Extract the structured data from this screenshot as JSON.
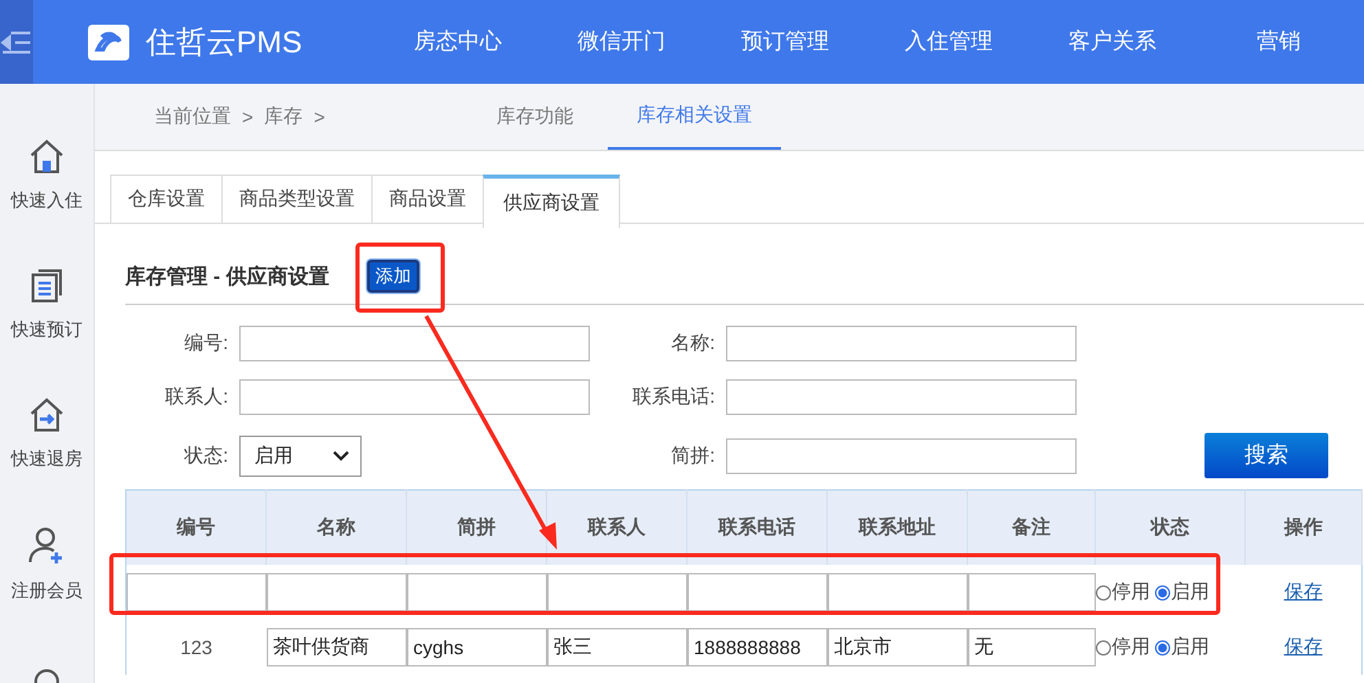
{
  "app": {
    "name": "住哲云PMS"
  },
  "top_nav": [
    {
      "label": "房态中心"
    },
    {
      "label": "微信开门"
    },
    {
      "label": "预订管理"
    },
    {
      "label": "入住管理"
    },
    {
      "label": "客户关系"
    },
    {
      "label": "营销"
    }
  ],
  "sidebar": [
    {
      "kind": "checkin",
      "label": "快速入住"
    },
    {
      "kind": "booking",
      "label": "快速预订"
    },
    {
      "kind": "checkout",
      "label": "快速退房"
    },
    {
      "kind": "member",
      "label": "注册会员"
    },
    {
      "kind": "search"
    }
  ],
  "breadcrumb": [
    "当前位置",
    ">",
    "库存",
    ">"
  ],
  "sub_tabs": [
    {
      "label": "库存功能",
      "selected": false
    },
    {
      "label": "库存相关设置",
      "selected": true
    }
  ],
  "tabs": [
    {
      "label": "仓库设置",
      "selected": false
    },
    {
      "label": "商品类型设置",
      "selected": false
    },
    {
      "label": "商品设置",
      "selected": false
    },
    {
      "label": "供应商设置",
      "selected": true
    }
  ],
  "section": {
    "title": "库存管理 - 供应商设置",
    "add_button": "添加"
  },
  "filters": [
    {
      "label": "编号:",
      "kind": "input"
    },
    {
      "label": "名称:",
      "kind": "input"
    },
    {
      "label": "联系人:",
      "kind": "input"
    },
    {
      "label": "联系电话:",
      "kind": "input"
    },
    {
      "label": "状态:",
      "kind": "select",
      "value": "启用"
    },
    {
      "label": "简拼:",
      "kind": "input"
    }
  ],
  "search_button": "搜索",
  "table": {
    "columns": [
      "编号",
      "名称",
      "简拼",
      "联系人",
      "联系电话",
      "联系地址",
      "备注",
      "状态",
      "操作"
    ],
    "rows": [
      {
        "cells": [
          {
            "kind": "input"
          },
          {
            "kind": "input"
          },
          {
            "kind": "input"
          },
          {
            "kind": "input"
          },
          {
            "kind": "input"
          },
          {
            "kind": "input"
          },
          {
            "kind": "input"
          }
        ],
        "status": [
          {
            "label": "停用",
            "selected": false
          },
          {
            "label": "启用",
            "selected": true
          }
        ],
        "action": "保存"
      },
      {
        "cells": [
          {
            "kind": "text",
            "value": "123"
          },
          {
            "kind": "input",
            "value": "茶叶供货商"
          },
          {
            "kind": "input",
            "value": "cyghs"
          },
          {
            "kind": "input",
            "value": "张三"
          },
          {
            "kind": "input",
            "value": "1888888888"
          },
          {
            "kind": "input",
            "value": "北京市"
          },
          {
            "kind": "input",
            "value": "无"
          }
        ],
        "status": [
          {
            "label": "停用",
            "selected": false
          },
          {
            "label": "启用",
            "selected": true
          }
        ],
        "action": "保存"
      }
    ]
  }
}
